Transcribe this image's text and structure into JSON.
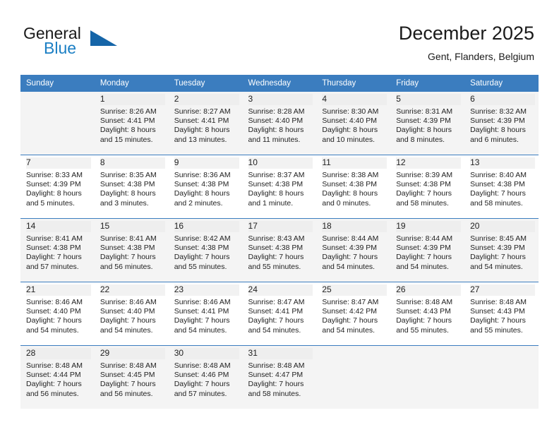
{
  "brand": {
    "name_part1": "General",
    "name_part2": "Blue",
    "triangle_color": "#1565a8",
    "blue_color": "#1b7fc4"
  },
  "header": {
    "month_title": "December 2025",
    "location": "Gent, Flanders, Belgium"
  },
  "theme": {
    "header_row_bg": "#3b7dbf",
    "header_row_text": "#ffffff",
    "shaded_row_bg": "#f4f4f4",
    "daynum_band_bg": "#eeeeee"
  },
  "weekdays": [
    "Sunday",
    "Monday",
    "Tuesday",
    "Wednesday",
    "Thursday",
    "Friday",
    "Saturday"
  ],
  "weeks": [
    [
      {
        "day": "",
        "empty": true
      },
      {
        "day": "1",
        "sunrise": "Sunrise: 8:26 AM",
        "sunset": "Sunset: 4:41 PM",
        "daylight1": "Daylight: 8 hours",
        "daylight2": "and 15 minutes."
      },
      {
        "day": "2",
        "sunrise": "Sunrise: 8:27 AM",
        "sunset": "Sunset: 4:41 PM",
        "daylight1": "Daylight: 8 hours",
        "daylight2": "and 13 minutes."
      },
      {
        "day": "3",
        "sunrise": "Sunrise: 8:28 AM",
        "sunset": "Sunset: 4:40 PM",
        "daylight1": "Daylight: 8 hours",
        "daylight2": "and 11 minutes."
      },
      {
        "day": "4",
        "sunrise": "Sunrise: 8:30 AM",
        "sunset": "Sunset: 4:40 PM",
        "daylight1": "Daylight: 8 hours",
        "daylight2": "and 10 minutes."
      },
      {
        "day": "5",
        "sunrise": "Sunrise: 8:31 AM",
        "sunset": "Sunset: 4:39 PM",
        "daylight1": "Daylight: 8 hours",
        "daylight2": "and 8 minutes."
      },
      {
        "day": "6",
        "sunrise": "Sunrise: 8:32 AM",
        "sunset": "Sunset: 4:39 PM",
        "daylight1": "Daylight: 8 hours",
        "daylight2": "and 6 minutes."
      }
    ],
    [
      {
        "day": "7",
        "sunrise": "Sunrise: 8:33 AM",
        "sunset": "Sunset: 4:39 PM",
        "daylight1": "Daylight: 8 hours",
        "daylight2": "and 5 minutes."
      },
      {
        "day": "8",
        "sunrise": "Sunrise: 8:35 AM",
        "sunset": "Sunset: 4:38 PM",
        "daylight1": "Daylight: 8 hours",
        "daylight2": "and 3 minutes."
      },
      {
        "day": "9",
        "sunrise": "Sunrise: 8:36 AM",
        "sunset": "Sunset: 4:38 PM",
        "daylight1": "Daylight: 8 hours",
        "daylight2": "and 2 minutes."
      },
      {
        "day": "10",
        "sunrise": "Sunrise: 8:37 AM",
        "sunset": "Sunset: 4:38 PM",
        "daylight1": "Daylight: 8 hours",
        "daylight2": "and 1 minute."
      },
      {
        "day": "11",
        "sunrise": "Sunrise: 8:38 AM",
        "sunset": "Sunset: 4:38 PM",
        "daylight1": "Daylight: 8 hours",
        "daylight2": "and 0 minutes."
      },
      {
        "day": "12",
        "sunrise": "Sunrise: 8:39 AM",
        "sunset": "Sunset: 4:38 PM",
        "daylight1": "Daylight: 7 hours",
        "daylight2": "and 58 minutes."
      },
      {
        "day": "13",
        "sunrise": "Sunrise: 8:40 AM",
        "sunset": "Sunset: 4:38 PM",
        "daylight1": "Daylight: 7 hours",
        "daylight2": "and 58 minutes."
      }
    ],
    [
      {
        "day": "14",
        "sunrise": "Sunrise: 8:41 AM",
        "sunset": "Sunset: 4:38 PM",
        "daylight1": "Daylight: 7 hours",
        "daylight2": "and 57 minutes."
      },
      {
        "day": "15",
        "sunrise": "Sunrise: 8:41 AM",
        "sunset": "Sunset: 4:38 PM",
        "daylight1": "Daylight: 7 hours",
        "daylight2": "and 56 minutes."
      },
      {
        "day": "16",
        "sunrise": "Sunrise: 8:42 AM",
        "sunset": "Sunset: 4:38 PM",
        "daylight1": "Daylight: 7 hours",
        "daylight2": "and 55 minutes."
      },
      {
        "day": "17",
        "sunrise": "Sunrise: 8:43 AM",
        "sunset": "Sunset: 4:38 PM",
        "daylight1": "Daylight: 7 hours",
        "daylight2": "and 55 minutes."
      },
      {
        "day": "18",
        "sunrise": "Sunrise: 8:44 AM",
        "sunset": "Sunset: 4:39 PM",
        "daylight1": "Daylight: 7 hours",
        "daylight2": "and 54 minutes."
      },
      {
        "day": "19",
        "sunrise": "Sunrise: 8:44 AM",
        "sunset": "Sunset: 4:39 PM",
        "daylight1": "Daylight: 7 hours",
        "daylight2": "and 54 minutes."
      },
      {
        "day": "20",
        "sunrise": "Sunrise: 8:45 AM",
        "sunset": "Sunset: 4:39 PM",
        "daylight1": "Daylight: 7 hours",
        "daylight2": "and 54 minutes."
      }
    ],
    [
      {
        "day": "21",
        "sunrise": "Sunrise: 8:46 AM",
        "sunset": "Sunset: 4:40 PM",
        "daylight1": "Daylight: 7 hours",
        "daylight2": "and 54 minutes."
      },
      {
        "day": "22",
        "sunrise": "Sunrise: 8:46 AM",
        "sunset": "Sunset: 4:40 PM",
        "daylight1": "Daylight: 7 hours",
        "daylight2": "and 54 minutes."
      },
      {
        "day": "23",
        "sunrise": "Sunrise: 8:46 AM",
        "sunset": "Sunset: 4:41 PM",
        "daylight1": "Daylight: 7 hours",
        "daylight2": "and 54 minutes."
      },
      {
        "day": "24",
        "sunrise": "Sunrise: 8:47 AM",
        "sunset": "Sunset: 4:41 PM",
        "daylight1": "Daylight: 7 hours",
        "daylight2": "and 54 minutes."
      },
      {
        "day": "25",
        "sunrise": "Sunrise: 8:47 AM",
        "sunset": "Sunset: 4:42 PM",
        "daylight1": "Daylight: 7 hours",
        "daylight2": "and 54 minutes."
      },
      {
        "day": "26",
        "sunrise": "Sunrise: 8:48 AM",
        "sunset": "Sunset: 4:43 PM",
        "daylight1": "Daylight: 7 hours",
        "daylight2": "and 55 minutes."
      },
      {
        "day": "27",
        "sunrise": "Sunrise: 8:48 AM",
        "sunset": "Sunset: 4:43 PM",
        "daylight1": "Daylight: 7 hours",
        "daylight2": "and 55 minutes."
      }
    ],
    [
      {
        "day": "28",
        "sunrise": "Sunrise: 8:48 AM",
        "sunset": "Sunset: 4:44 PM",
        "daylight1": "Daylight: 7 hours",
        "daylight2": "and 56 minutes."
      },
      {
        "day": "29",
        "sunrise": "Sunrise: 8:48 AM",
        "sunset": "Sunset: 4:45 PM",
        "daylight1": "Daylight: 7 hours",
        "daylight2": "and 56 minutes."
      },
      {
        "day": "30",
        "sunrise": "Sunrise: 8:48 AM",
        "sunset": "Sunset: 4:46 PM",
        "daylight1": "Daylight: 7 hours",
        "daylight2": "and 57 minutes."
      },
      {
        "day": "31",
        "sunrise": "Sunrise: 8:48 AM",
        "sunset": "Sunset: 4:47 PM",
        "daylight1": "Daylight: 7 hours",
        "daylight2": "and 58 minutes."
      },
      {
        "day": "",
        "empty": true
      },
      {
        "day": "",
        "empty": true
      },
      {
        "day": "",
        "empty": true
      }
    ]
  ]
}
